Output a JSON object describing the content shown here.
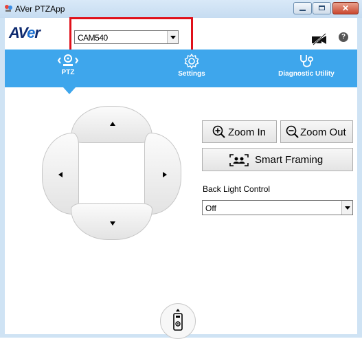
{
  "window": {
    "title": "AVer PTZApp",
    "close_glyph": "✕"
  },
  "header": {
    "logo": {
      "part1": "AV",
      "part2": "e",
      "part3": "r"
    },
    "camera_select": {
      "value": "CAM540"
    },
    "help_glyph": "?"
  },
  "tabs": [
    {
      "label": "PTZ",
      "icon": "ptz-camera-icon",
      "active": true
    },
    {
      "label": "Settings",
      "icon": "gear-icon",
      "active": false
    },
    {
      "label": "Diagnostic Utility",
      "icon": "stethoscope-icon",
      "active": false
    }
  ],
  "ptz": {
    "zoom_in_label": "Zoom In",
    "zoom_out_label": "Zoom Out",
    "smart_framing_label": "Smart Framing",
    "back_light_label": "Back Light Control",
    "back_light_value": "Off"
  },
  "colors": {
    "tab_bar": "#3ea6ec",
    "highlight": "#e0101a",
    "logo": "#0e2a6f"
  }
}
